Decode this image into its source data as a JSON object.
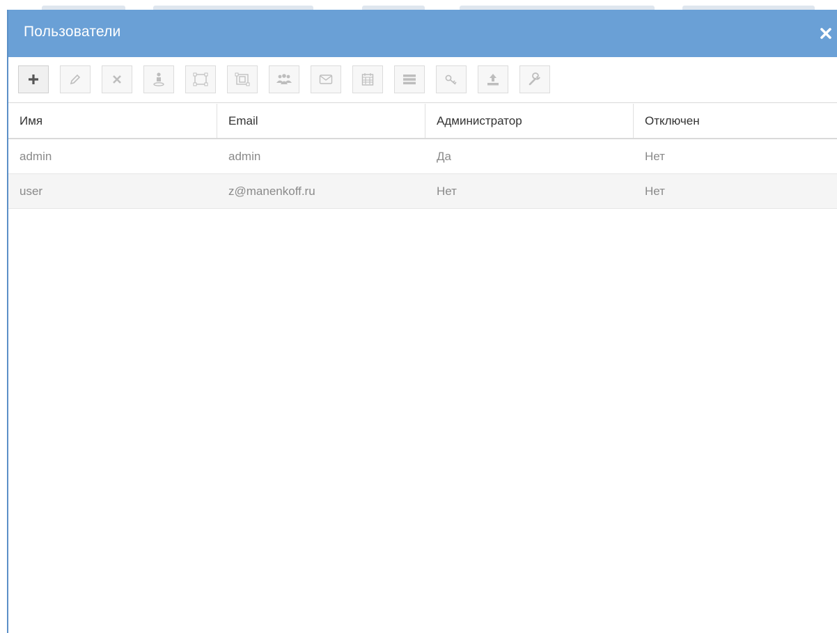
{
  "dialog": {
    "title": "Пользователи",
    "close_icon": "close-icon",
    "accent_color": "#6aa0d6"
  },
  "toolbar": {
    "buttons": [
      {
        "name": "add-button",
        "icon": "plus-icon",
        "enabled": true
      },
      {
        "name": "edit-button",
        "icon": "pencil-icon",
        "enabled": false
      },
      {
        "name": "delete-button",
        "icon": "cross-icon",
        "enabled": false
      },
      {
        "name": "user-location-button",
        "icon": "person-pin-icon",
        "enabled": false
      },
      {
        "name": "layout-button",
        "icon": "object-group-icon",
        "enabled": false
      },
      {
        "name": "layout-alt-button",
        "icon": "object-ungroup-icon",
        "enabled": false
      },
      {
        "name": "groups-button",
        "icon": "users-icon",
        "enabled": false
      },
      {
        "name": "mail-button",
        "icon": "envelope-icon",
        "enabled": false
      },
      {
        "name": "calendar-button",
        "icon": "calendar-icon",
        "enabled": false
      },
      {
        "name": "list-button",
        "icon": "list-icon",
        "enabled": false
      },
      {
        "name": "key-button",
        "icon": "key-icon",
        "enabled": false
      },
      {
        "name": "upload-button",
        "icon": "upload-icon",
        "enabled": false
      },
      {
        "name": "settings-button",
        "icon": "wrench-icon",
        "enabled": false
      }
    ]
  },
  "grid": {
    "columns": [
      "Имя",
      "Email",
      "Администратор",
      "Отключен"
    ],
    "rows": [
      [
        "admin",
        "admin",
        "Да",
        "Нет"
      ],
      [
        "user",
        "z@manenkoff.ru",
        "Нет",
        "Нет"
      ]
    ]
  }
}
